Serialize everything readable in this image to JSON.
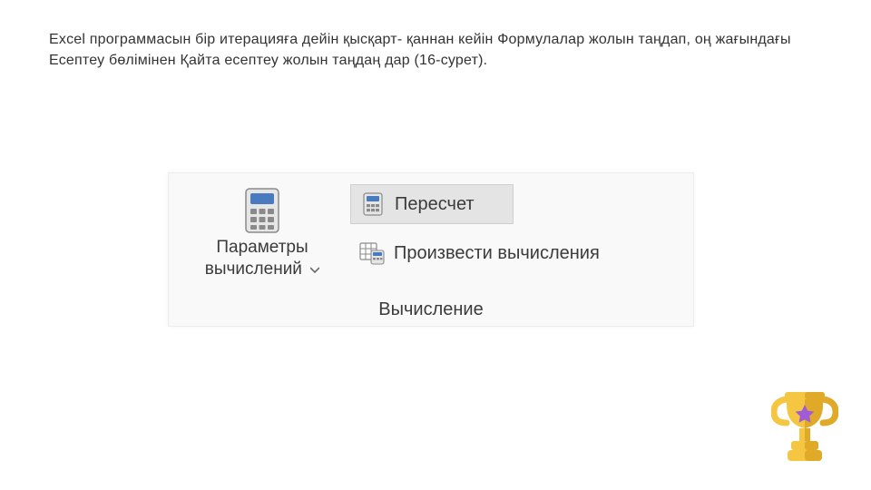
{
  "instruction": "Excel программасын бір итерацияға дейін қысқарт- қаннан кейін Формулалар жолын таңдап, оң жағындағы Есептеу бөлімінен Қайта есептеу жолын таңдаң дар (16-сурет).",
  "ribbon": {
    "param_button": {
      "label_line1": "Параметры",
      "label_line2": "вычислений"
    },
    "recalc_button": {
      "label": "Пересчет"
    },
    "calc_now_button": {
      "label": "Произвести вычисления"
    },
    "group_caption": "Вычисление"
  },
  "icons": {
    "calculator": "calculator-icon",
    "calc_small": "calculator-small-icon",
    "sheet_calc": "sheet-calc-icon",
    "caret": "chevron-down-icon",
    "trophy": "trophy-icon"
  },
  "colors": {
    "trophy_gold": "#f5c642",
    "trophy_shadow": "#e0a928",
    "trophy_star": "#a05bd8",
    "calc_blue": "#4a7bbf",
    "calc_body": "#e6e6e6",
    "calc_border": "#8a8a8a"
  }
}
